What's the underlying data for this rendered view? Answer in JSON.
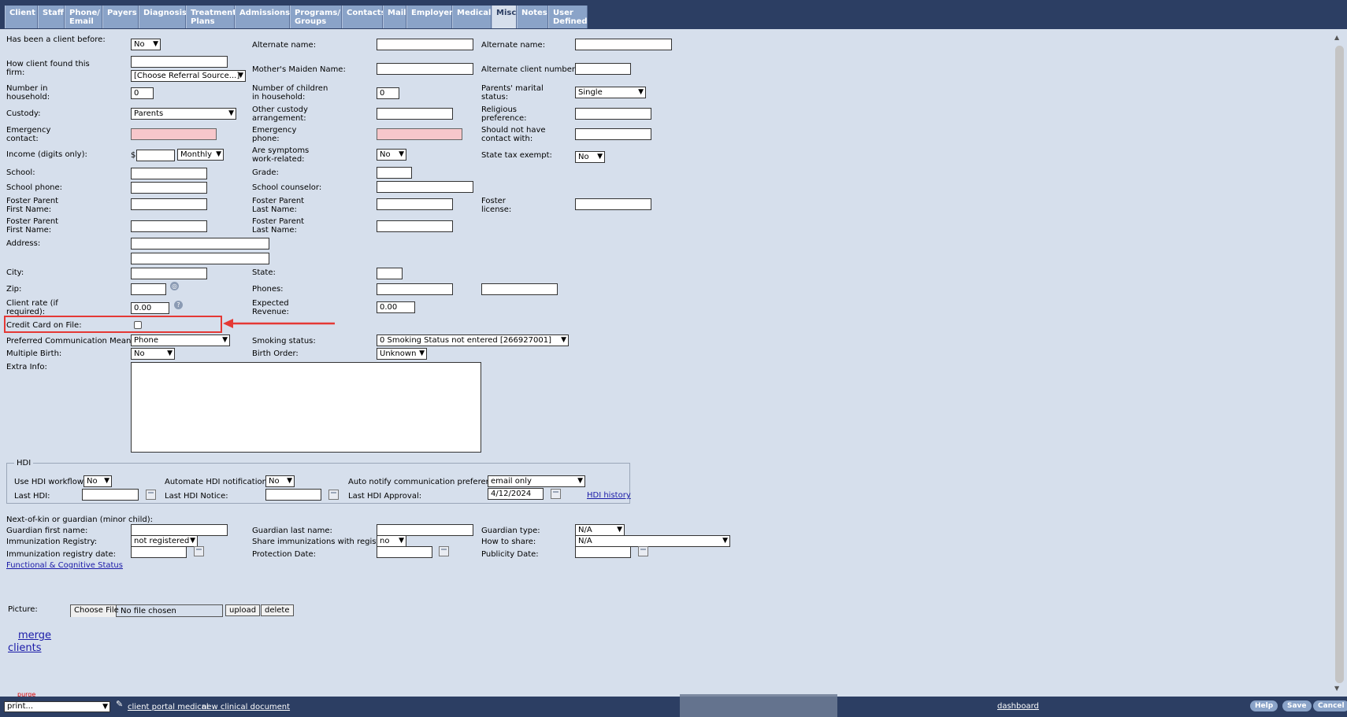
{
  "tabs": [
    "Client",
    "Staff",
    "Phone/ Email",
    "Payers",
    "Diagnosis",
    "Treatment Plans",
    "Admissions",
    "Programs/ Groups",
    "Contacts",
    "Mail",
    "Employer",
    "Medical",
    "Misc",
    "Notes",
    "User Defined"
  ],
  "col1": {
    "been_client_label": "Has been a client before:",
    "been_client_value": "No",
    "how_found_label": "How client found this firm:",
    "how_found_value": "[Choose Referral Source...]",
    "num_household_label": "Number in household:",
    "num_household_value": "0",
    "custody_label": "Custody:",
    "custody_value": "Parents",
    "emergency_contact_label": "Emergency contact:",
    "income_label": "Income (digits only):",
    "income_currency": "$",
    "income_freq": "Monthly",
    "school_label": "School:",
    "school_phone_label": "School phone:",
    "foster_first1_label": "Foster Parent First Name:",
    "foster_first2_label": "Foster Parent First Name:",
    "address_label": "Address:",
    "city_label": "City:",
    "zip_label": "Zip:",
    "client_rate_label": "Client rate (if required):",
    "client_rate_value": "0.00",
    "credit_card_label": "Credit Card on File:",
    "pref_comm_label": "Preferred Communication Means:",
    "pref_comm_value": "Phone",
    "multiple_birth_label": "Multiple Birth:",
    "multiple_birth_value": "No",
    "extra_info_label": "Extra Info:"
  },
  "col2": {
    "alt_name_label": "Alternate name:",
    "maiden_label": "Mother's Maiden Name:",
    "num_children_label": "Number of children in household:",
    "num_children_value": "0",
    "other_custody_label": "Other custody arrangement:",
    "emergency_phone_label": "Emergency phone:",
    "symptoms_label": "Are symptoms work-related:",
    "symptoms_value": "No",
    "grade_label": "Grade:",
    "counselor_label": "School counselor:",
    "foster_last1_label": "Foster Parent Last Name:",
    "foster_last2_label": "Foster Parent Last Name:",
    "state_label": "State:",
    "phones_label": "Phones:",
    "expected_revenue_label": "Expected Revenue:",
    "expected_revenue_value": "0.00",
    "smoking_label": "Smoking status:",
    "smoking_value": "0 Smoking Status not entered [266927001]",
    "birth_order_label": "Birth Order:",
    "birth_order_value": "Unknown"
  },
  "col3": {
    "alt_name_label": "Alternate name:",
    "alt_client_num_label": "Alternate client number:",
    "marital_label": "Parents' marital status:",
    "marital_value": "Single",
    "religious_label": "Religious preference:",
    "no_contact_label": "Should not have contact with:",
    "tax_exempt_label": "State tax exempt:",
    "tax_exempt_value": "No",
    "foster_license_label": "Foster license:"
  },
  "hdi": {
    "legend": "HDI",
    "use_workflow_label": "Use HDI workflow:",
    "use_workflow_value": "No",
    "automate_label": "Automate HDI notifications:",
    "automate_value": "No",
    "auto_notify_label": "Auto notify communication preference:",
    "auto_notify_value": "email only",
    "last_hdi_label": "Last HDI:",
    "last_notice_label": "Last HDI Notice:",
    "last_approval_label": "Last HDI Approval:",
    "last_approval_value": "4/12/2024",
    "history_link": "HDI history"
  },
  "guardian": {
    "section_label": "Next-of-kin or guardian (minor child):",
    "first_name_label": "Guardian first name:",
    "last_name_label": "Guardian last name:",
    "type_label": "Guardian type:",
    "type_value": "N/A",
    "immunization_label": "Immunization Registry:",
    "immunization_value": "not registered",
    "share_label": "Share immunizations with registry:",
    "share_value": "no",
    "how_share_label": "How to share:",
    "how_share_value": "N/A",
    "registry_date_label": "Immunization registry date:",
    "protection_label": "Protection Date:",
    "publicity_label": "Publicity Date:",
    "functional_link": "Functional & Cognitive Status"
  },
  "picture": {
    "label": "Picture:",
    "choose_file": "Choose File",
    "no_file": "No file chosen",
    "upload": "upload",
    "delete": "delete"
  },
  "merge_link_1": "merge",
  "merge_link_2": "clients",
  "purge_text": "purge",
  "footer": {
    "print_value": "print...",
    "portal_link": "client portal medical",
    "clinical_link": "new clinical document",
    "dashboard_link": "dashboard",
    "help": "Help",
    "save": "Save",
    "cancel": "Cancel"
  },
  "colors": {
    "header": "#2c3e63",
    "tab": "#8aa3c8",
    "bg": "#d6dfec",
    "required": "#f7c7cb",
    "highlight": "#e53935"
  }
}
